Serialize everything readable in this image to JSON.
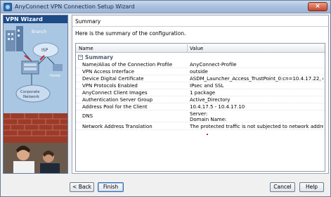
{
  "window": {
    "title": "AnyConnect VPN Connection Setup Wizard",
    "close_glyph": "×"
  },
  "side": {
    "title": "VPN Wizard",
    "labels": {
      "branch": "Branch",
      "isp": "ISP",
      "home": "Home",
      "corporate": "Corporate",
      "network": "Network"
    }
  },
  "main": {
    "header": "Summary",
    "caption": "Here is the summary of the configuration.",
    "table": {
      "columns": [
        "Name",
        "Value"
      ],
      "group_toggle": "−",
      "group": "Summary",
      "rows": [
        {
          "name": "Name/Alias of the Connection Profile",
          "value": "AnyConnect-Profile"
        },
        {
          "name": "VPN Access Interface",
          "value": "outside"
        },
        {
          "name": "Device Digital Certificate",
          "value": "ASDM_Launcher_Access_TrustPoint_0:cn=10.4.17.22, c..."
        },
        {
          "name": "VPN Protocols Enabled",
          "value": "IPsec and SSL"
        },
        {
          "name": "AnyConnect Client Images",
          "value": "1 package"
        },
        {
          "name": "Authentication Server Group",
          "value": "Active_Directory"
        },
        {
          "name": "Address Pool for the Client",
          "value": "10.4.17.5 - 10.4.17.10"
        }
      ],
      "dns": {
        "name": "DNS",
        "server": "Server:",
        "domain": "Domain Name:"
      },
      "nat": {
        "name": "Network Address Translation",
        "value": "The protected traffic is not subjected to network address translation"
      }
    }
  },
  "buttons": {
    "back": "< Back",
    "finish": "Finish",
    "cancel": "Cancel",
    "help": "Help"
  },
  "colors": {
    "accent": "#1e4a85",
    "side_bg": "#a7c6e1",
    "brick": "#9b3b2a"
  }
}
